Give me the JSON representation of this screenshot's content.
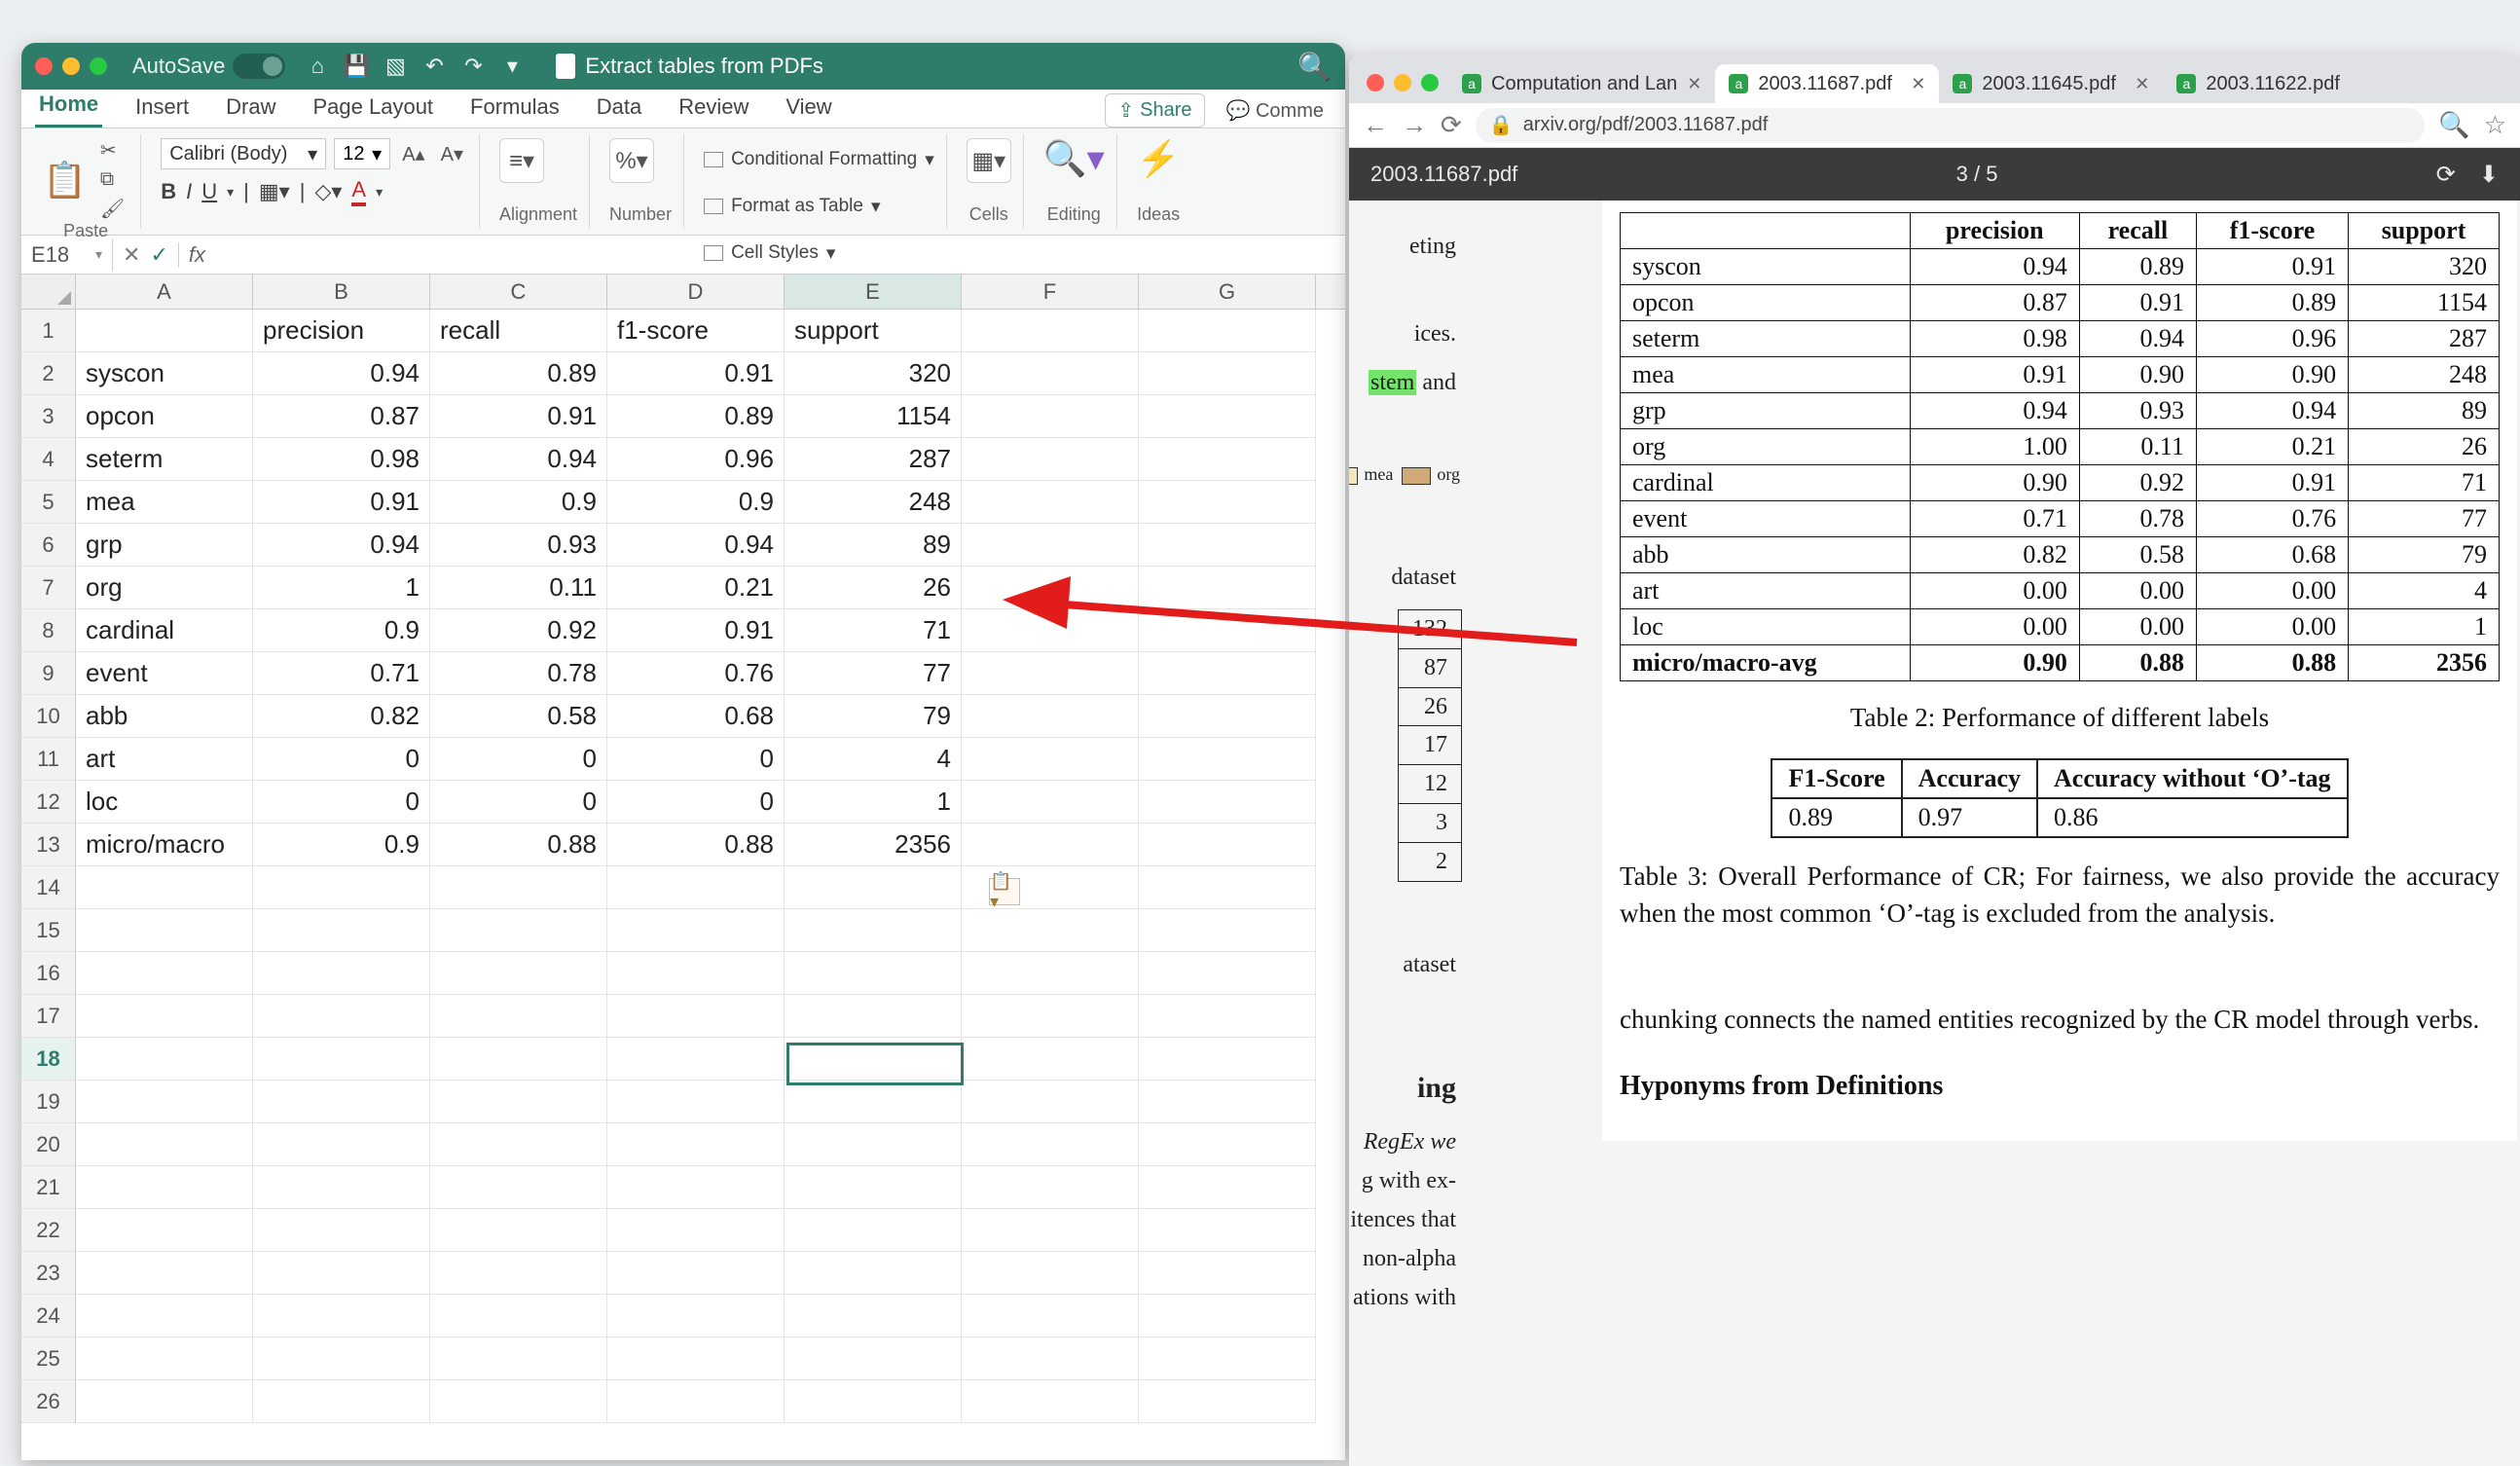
{
  "excel": {
    "autosave_label": "AutoSave",
    "doc_title": "Extract tables from PDFs",
    "tabs": [
      "Home",
      "Insert",
      "Draw",
      "Page Layout",
      "Formulas",
      "Data",
      "Review",
      "View"
    ],
    "active_tab": "Home",
    "share_label": "Share",
    "comments_label": "Comme",
    "ribbon": {
      "paste_label": "Paste",
      "font_name": "Calibri (Body)",
      "font_size": "12",
      "group_alignment": "Alignment",
      "group_number": "Number",
      "styles": {
        "cond": "Conditional Formatting",
        "table": "Format as Table",
        "cell": "Cell Styles"
      },
      "cells_label": "Cells",
      "editing_label": "Editing",
      "ideas_label": "Ideas"
    },
    "namebox": "E18",
    "fx_label": "fx",
    "columns": [
      "A",
      "B",
      "C",
      "D",
      "E",
      "F",
      "G"
    ],
    "headers": {
      "B": "precision",
      "C": "recall",
      "D": "f1-score",
      "E": "support"
    },
    "data_rows": [
      {
        "r": "2",
        "A": "syscon",
        "B": "0.94",
        "C": "0.89",
        "D": "0.91",
        "E": "320"
      },
      {
        "r": "3",
        "A": "opcon",
        "B": "0.87",
        "C": "0.91",
        "D": "0.89",
        "E": "1154"
      },
      {
        "r": "4",
        "A": "seterm",
        "B": "0.98",
        "C": "0.94",
        "D": "0.96",
        "E": "287"
      },
      {
        "r": "5",
        "A": "mea",
        "B": "0.91",
        "C": "0.9",
        "D": "0.9",
        "E": "248"
      },
      {
        "r": "6",
        "A": "grp",
        "B": "0.94",
        "C": "0.93",
        "D": "0.94",
        "E": "89"
      },
      {
        "r": "7",
        "A": "org",
        "B": "1",
        "C": "0.11",
        "D": "0.21",
        "E": "26"
      },
      {
        "r": "8",
        "A": "cardinal",
        "B": "0.9",
        "C": "0.92",
        "D": "0.91",
        "E": "71"
      },
      {
        "r": "9",
        "A": "event",
        "B": "0.71",
        "C": "0.78",
        "D": "0.76",
        "E": "77"
      },
      {
        "r": "10",
        "A": "abb",
        "B": "0.82",
        "C": "0.58",
        "D": "0.68",
        "E": "79"
      },
      {
        "r": "11",
        "A": "art",
        "B": "0",
        "C": "0",
        "D": "0",
        "E": "4"
      },
      {
        "r": "12",
        "A": "loc",
        "B": "0",
        "C": "0",
        "D": "0",
        "E": "1"
      },
      {
        "r": "13",
        "A": "micro/macro",
        "B": "0.9",
        "C": "0.88",
        "D": "0.88",
        "E": "2356"
      }
    ],
    "extra_rows": [
      "14",
      "15",
      "16",
      "17",
      "18",
      "19",
      "20",
      "21",
      "22",
      "23",
      "24",
      "25",
      "26"
    ]
  },
  "chrome": {
    "tabs": [
      {
        "title": "Computation and Lan",
        "active": false,
        "closable": true
      },
      {
        "title": "2003.11687.pdf",
        "active": true,
        "closable": true
      },
      {
        "title": "2003.11645.pdf",
        "active": false,
        "closable": true
      },
      {
        "title": "2003.11622.pdf",
        "active": false,
        "closable": false
      }
    ],
    "url": "arxiv.org/pdf/2003.11687.pdf",
    "pdfbar": {
      "title": "2003.11687.pdf",
      "page": "3 / 5"
    },
    "left_fragments": {
      "eting": "eting",
      "ices": "ices.",
      "stem": "stem",
      "and": " and",
      "mea": "mea",
      "org": "org",
      "dataset": "dataset",
      "mini_vals": [
        "132",
        "87",
        "26",
        "17",
        "12",
        "3",
        "2"
      ],
      "ataset": "ataset",
      "ing": "ing",
      "regex": " RegEx we",
      "f1": "g with ex-",
      "f2": "itences that",
      "f3": " non-alpha",
      "f4": "ations with"
    },
    "table2": {
      "head": [
        "",
        "precision",
        "recall",
        "f1-score",
        "support"
      ],
      "rows": [
        [
          "syscon",
          "0.94",
          "0.89",
          "0.91",
          "320"
        ],
        [
          "opcon",
          "0.87",
          "0.91",
          "0.89",
          "1154"
        ],
        [
          "seterm",
          "0.98",
          "0.94",
          "0.96",
          "287"
        ],
        [
          "mea",
          "0.91",
          "0.90",
          "0.90",
          "248"
        ],
        [
          "grp",
          "0.94",
          "0.93",
          "0.94",
          "89"
        ],
        [
          "org",
          "1.00",
          "0.11",
          "0.21",
          "26"
        ],
        [
          "cardinal",
          "0.90",
          "0.92",
          "0.91",
          "71"
        ],
        [
          "event",
          "0.71",
          "0.78",
          "0.76",
          "77"
        ],
        [
          "abb",
          "0.82",
          "0.58",
          "0.68",
          "79"
        ],
        [
          "art",
          "0.00",
          "0.00",
          "0.00",
          "4"
        ],
        [
          "loc",
          "0.00",
          "0.00",
          "0.00",
          "1"
        ]
      ],
      "avg": [
        "micro/macro-avg",
        "0.90",
        "0.88",
        "0.88",
        "2356"
      ],
      "caption": "Table 2: Performance of different labels"
    },
    "table3": {
      "head": [
        "F1-Score",
        "Accuracy",
        "Accuracy without ‘O’-tag"
      ],
      "row": [
        "0.89",
        "0.97",
        "0.86"
      ],
      "caption": "Table 3: Overall Performance of CR; For fairness, we also provide the accuracy when the most common ‘O’-tag is excluded from the analysis."
    },
    "body1": "chunking connects the named entities recognized by the CR model through verbs.",
    "subhead": "Hyponyms from Definitions"
  }
}
